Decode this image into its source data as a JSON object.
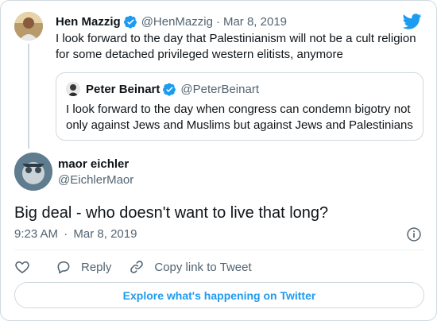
{
  "colors": {
    "accent": "#1d9bf0",
    "text": "#0f1419",
    "muted": "#536471",
    "border": "#cfd9de"
  },
  "parent_tweet": {
    "name": "Hen Mazzig",
    "handle": "@HenMazzig",
    "separator": "·",
    "date": "Mar 8, 2019",
    "text": "I look forward to the day that Palestinianism will not be a cult religion for some detached privileged western elitists, anymore",
    "verified_icon": "verified-badge-icon"
  },
  "quoted_tweet": {
    "name": "Peter Beinart",
    "handle": "@PeterBeinart",
    "text": "I look forward to the day when congress can condemn bigotry not only against Jews and Muslims but against Jews and Palestinians",
    "verified_icon": "verified-badge-icon"
  },
  "main_tweet": {
    "name": "maor eichler",
    "handle": "@EichlerMaor",
    "text": "Big deal - who doesn't want to live that long?",
    "time": "9:23 AM",
    "separator": "·",
    "date": "Mar 8, 2019"
  },
  "actions": {
    "like_icon": "heart-icon",
    "reply_label": "Reply",
    "copy_link_label": "Copy link to Tweet"
  },
  "explore_button": {
    "label": "Explore what's happening on Twitter"
  }
}
